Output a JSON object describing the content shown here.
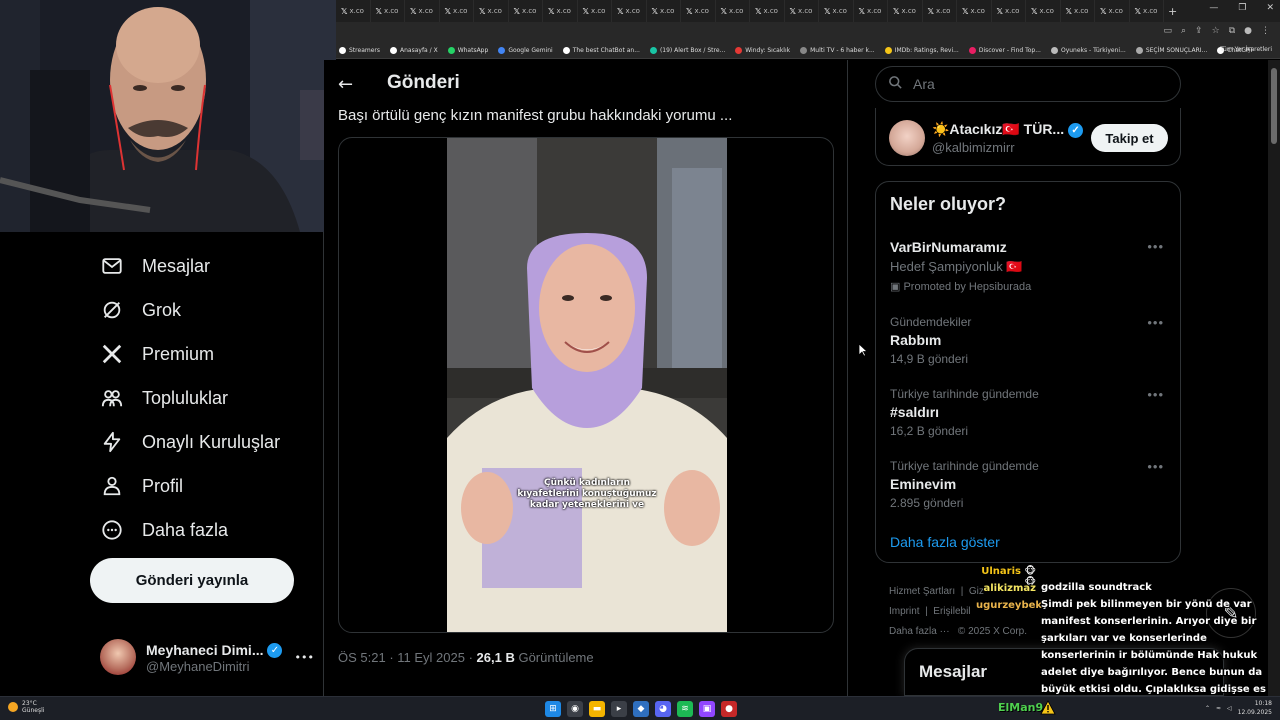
{
  "browser": {
    "tab_label": "x.co",
    "tab_count": 24,
    "new_tab": "+",
    "window_controls": [
      "—",
      "❐",
      "✕"
    ],
    "bookmarks": [
      {
        "label": "Streamers",
        "color": "#ffffff"
      },
      {
        "label": "Anasayfa / X",
        "color": "#ffffff"
      },
      {
        "label": "WhatsApp",
        "color": "#25d366"
      },
      {
        "label": "Google Gemini",
        "color": "#4285f4"
      },
      {
        "label": "The best ChatBot an...",
        "color": "#ffffff"
      },
      {
        "label": "(19) Alert Box / Stre...",
        "color": "#19c5a5"
      },
      {
        "label": "Windy: Sıcaklık",
        "color": "#e53935"
      },
      {
        "label": "Multi TV - 6 haber k...",
        "color": "#888888"
      },
      {
        "label": "IMDb: Ratings, Revi...",
        "color": "#f5c518"
      },
      {
        "label": "Discover - Find Top...",
        "color": "#e91e63"
      },
      {
        "label": "Oyuneks - Türkiyeni...",
        "color": "#bbbbbb"
      },
      {
        "label": "SEÇİM SONUÇLARI...",
        "color": "#aaaaaa"
      },
      {
        "label": "ChatGPT",
        "color": "#ffffff"
      }
    ],
    "all_bookmarks": "Tüm Yer İşaretleri"
  },
  "left_nav": {
    "items": [
      {
        "label": "Mesajlar",
        "icon": "mail-icon"
      },
      {
        "label": "Grok",
        "icon": "grok-icon"
      },
      {
        "label": "Premium",
        "icon": "x-logo-icon"
      },
      {
        "label": "Topluluklar",
        "icon": "communities-icon"
      },
      {
        "label": "Onaylı Kuruluşlar",
        "icon": "lightning-icon"
      },
      {
        "label": "Profil",
        "icon": "person-icon"
      },
      {
        "label": "Daha fazla",
        "icon": "more-circle-icon"
      }
    ],
    "post_button": "Gönderi yayınla",
    "account": {
      "name": "Meyhaneci Dimi...",
      "handle": "@MeyhaneDimitri",
      "more": "•••"
    }
  },
  "main": {
    "header_title": "Gönderi",
    "post_text": "Başı örtülü genç kızın manifest grubu hakkındaki yorumu ...",
    "video_caption": "Çünkü kadınların kıyafetlerini konuştuğumuz kadar yeteneklerini ve",
    "time": "ÖS 5:21",
    "date": "11 Eyl 2025",
    "views": "26,1 B",
    "views_label": "Görüntüleme"
  },
  "right": {
    "search_placeholder": "Ara",
    "follow_card": {
      "name": "☀️Atacıkız🇹🇷 TÜR...",
      "handle": "@kalbimizmirr",
      "button": "Takip et"
    },
    "trends_title": "Neler oluyor?",
    "promoted": {
      "title": "VarBirNumaramız",
      "subtitle": "Hedef Şampiyonluk 🇹🇷",
      "by": "Promoted by Hepsiburada"
    },
    "trends": [
      {
        "context": "Gündemdekiler",
        "name": "Rabbım",
        "count": "14,9 B gönderi"
      },
      {
        "context": "Türkiye tarihinde gündemde",
        "name": "#saldırı",
        "count": "16,2 B gönderi"
      },
      {
        "context": "Türkiye tarihinde gündemde",
        "name": "Eminevim",
        "count": "2.895 gönderi"
      }
    ],
    "show_more": "Daha fazla göster",
    "footer": [
      "Hizmet Şartları",
      "|",
      "Giz",
      "Imprint",
      "|",
      "Erişilebil",
      "Daha fazla ···",
      "© 2025 X Corp."
    ],
    "messages_drawer": "Mesajlar"
  },
  "chat": {
    "users": [
      {
        "name": "Ulnaris",
        "color": "#f5c518"
      },
      {
        "name": "alikizmaz",
        "color": "#f5e663"
      },
      {
        "name": "ugurzeybek",
        "color": "#e9b44c"
      }
    ],
    "messages": [
      "godzilla soundtrack",
      "Şimdi pek bilinmeyen bir yönü de var manifest konserlerinin. Arıyor diye bir şarkıları var ve konserlerinde konserlerinin ir bölümünde Hak hukuk adelet diye bağırılıyor. Bence bunun da büyük etkisi oldu. Çıplaklıksa gidişse es örnekleri varken neden sadece Manifest?"
    ],
    "overlay_name": "ElMan9"
  },
  "taskbar": {
    "temperature": "23°C",
    "weather": "Güneşli",
    "time": "10:18",
    "date": "12.09.2025",
    "start_icon": "windows-start-icon"
  }
}
